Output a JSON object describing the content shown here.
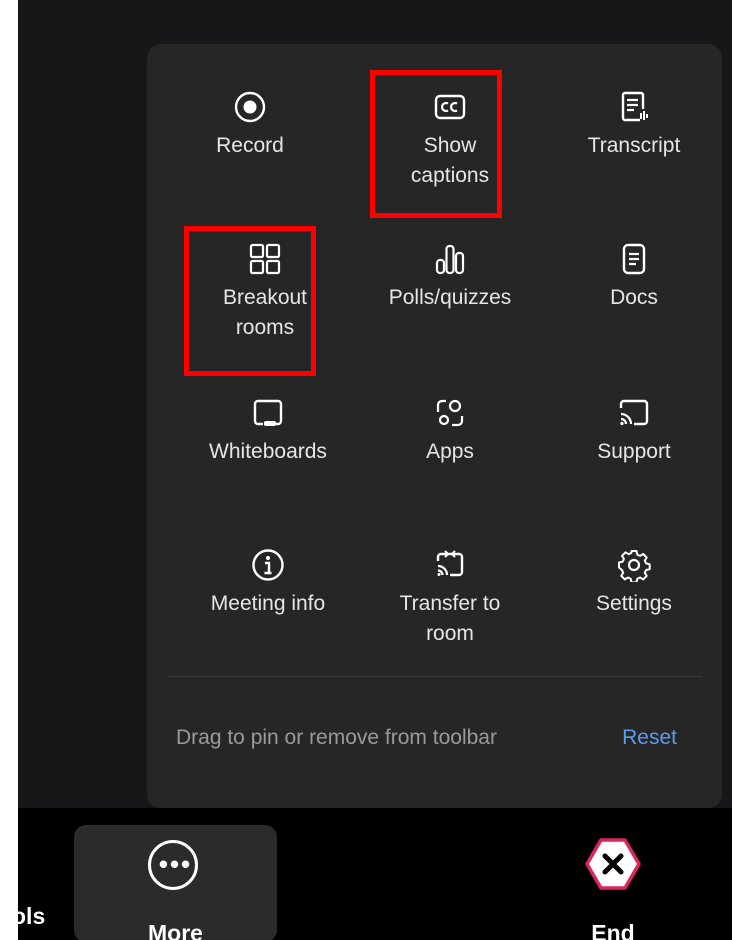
{
  "menu": {
    "items": [
      {
        "label": "Record",
        "icon": "record-icon"
      },
      {
        "label": "Show\ncaptions",
        "icon": "closed-captions-icon"
      },
      {
        "label": "Transcript",
        "icon": "transcript-icon"
      },
      {
        "label": "Breakout\nrooms",
        "icon": "breakout-rooms-icon"
      },
      {
        "label": "Polls/quizzes",
        "icon": "polls-icon"
      },
      {
        "label": "Docs",
        "icon": "document-icon"
      },
      {
        "label": "Whiteboards",
        "icon": "whiteboard-icon"
      },
      {
        "label": "Apps",
        "icon": "apps-icon"
      },
      {
        "label": "Support",
        "icon": "cast-support-icon"
      },
      {
        "label": "Meeting info",
        "icon": "info-icon"
      },
      {
        "label": "Transfer to\nroom",
        "icon": "transfer-to-room-icon"
      },
      {
        "label": "Settings",
        "icon": "gear-icon"
      }
    ],
    "hint": "Drag to pin or remove from toolbar",
    "reset_label": "Reset"
  },
  "toolbar": {
    "tools_label": "ols",
    "more_label": "More",
    "more_dots": "•••",
    "end_label": "End"
  },
  "colors": {
    "panel": "#262626",
    "highlight": "#ff0000",
    "link": "#5b9bf0",
    "end": "#e0245e"
  }
}
